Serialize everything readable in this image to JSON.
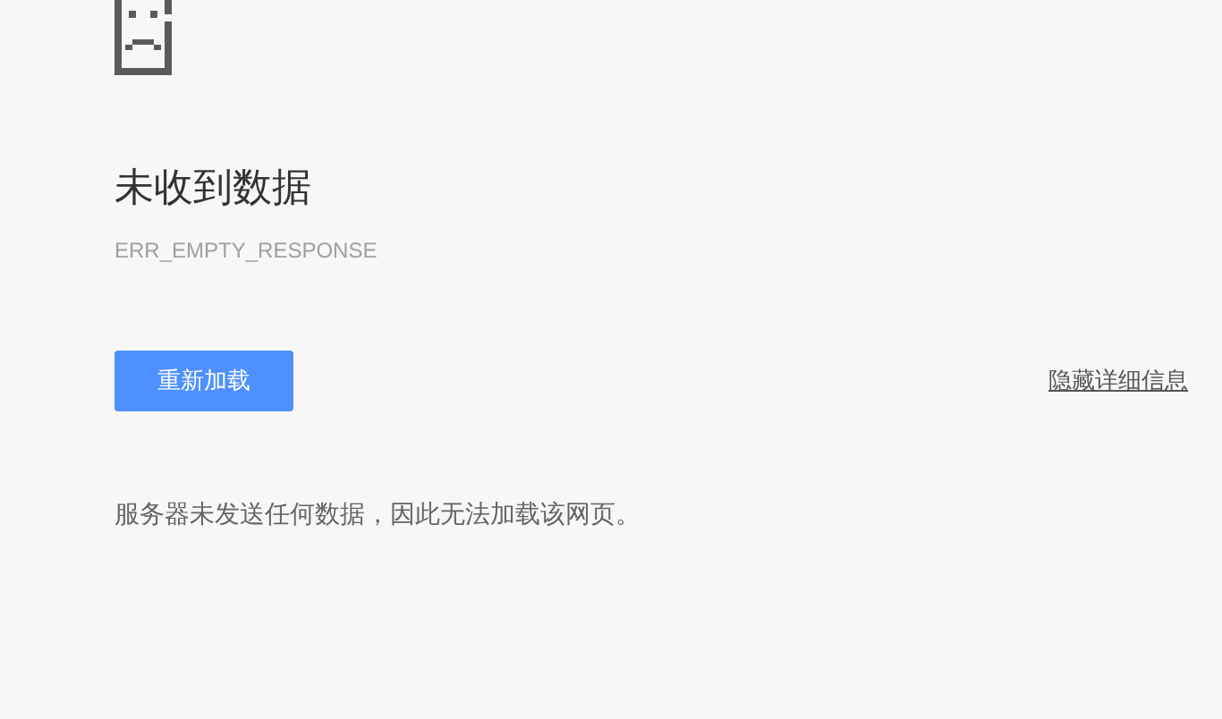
{
  "error": {
    "title": "未收到数据",
    "code": "ERR_EMPTY_RESPONSE"
  },
  "reload_button": "重新加载",
  "details_link": "隐藏详细信息",
  "details_text": "服务器未发送任何数据，因此无法加载该网页。"
}
